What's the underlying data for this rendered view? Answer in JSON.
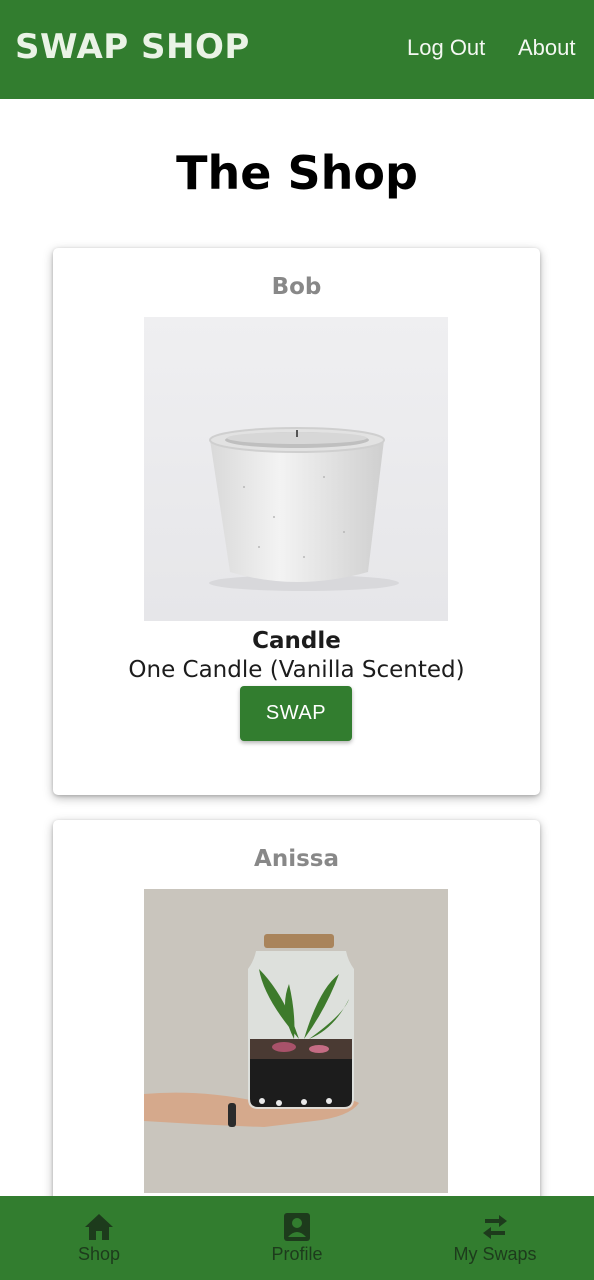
{
  "header": {
    "brand": "SWAP SHOP",
    "links": {
      "logout": "Log Out",
      "about": "About"
    }
  },
  "page_title": "The Shop",
  "items": [
    {
      "owner": "Bob",
      "photo_icon": "candle-photo",
      "name": "Candle",
      "description": "One Candle (Vanilla Scented)",
      "button_label": "SWAP"
    },
    {
      "owner": "Anissa",
      "photo_icon": "terrarium-photo"
    }
  ],
  "bottom_nav": {
    "shop": {
      "label": "Shop",
      "icon": "home-icon"
    },
    "profile": {
      "label": "Profile",
      "icon": "profile-icon"
    },
    "swaps": {
      "label": "My Swaps",
      "icon": "swap-arrows-icon"
    }
  },
  "colors": {
    "primary": "#327d2f",
    "nav_icon": "#1d3b1c",
    "owner_text": "#888888"
  }
}
